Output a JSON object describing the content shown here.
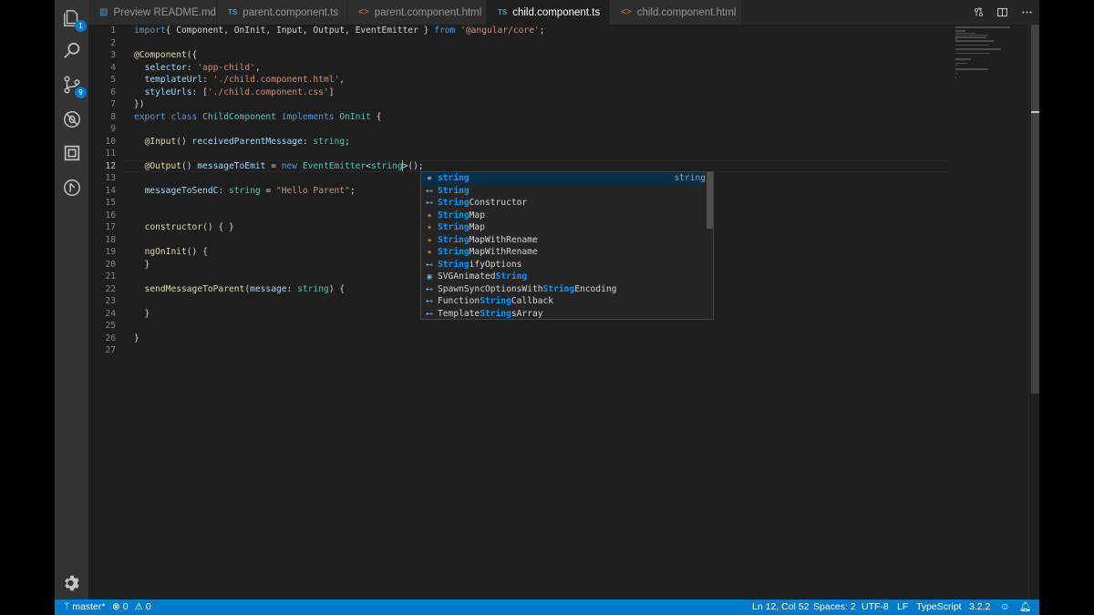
{
  "tabs": [
    {
      "label": "Preview README.md",
      "icon": "preview-icon",
      "active": false
    },
    {
      "label": "parent.component.ts",
      "icon": "ts-icon",
      "icon_text": "TS",
      "active": false
    },
    {
      "label": "parent.component.html",
      "icon": "html-icon",
      "icon_text": "<>",
      "active": false
    },
    {
      "label": "child.component.ts",
      "icon": "ts-icon",
      "icon_text": "TS",
      "active": true,
      "dirty": true
    },
    {
      "label": "child.component.html",
      "icon": "html-icon",
      "icon_text": "<>",
      "active": false
    }
  ],
  "activity_bar": {
    "explorer_badge": "1",
    "scm_badge": "9"
  },
  "editor": {
    "current_line": 12,
    "lines": [
      {
        "n": "1",
        "segments": [
          [
            "kw",
            "import"
          ],
          [
            "",
            "{ Component, OnInit, Input, Output, EventEmitter } "
          ],
          [
            "kw",
            "from"
          ],
          [
            "",
            " "
          ],
          [
            "str",
            "'@angular/core'"
          ],
          [
            "",
            ";"
          ]
        ]
      },
      {
        "n": "2",
        "segments": []
      },
      {
        "n": "3",
        "segments": [
          [
            "dec",
            "@Component"
          ],
          [
            "",
            "({"
          ]
        ]
      },
      {
        "n": "4",
        "segments": [
          [
            "",
            "  "
          ],
          [
            "prop",
            "selector"
          ],
          [
            "",
            ": "
          ],
          [
            "str",
            "'app-child'"
          ],
          [
            "",
            ","
          ]
        ]
      },
      {
        "n": "5",
        "segments": [
          [
            "",
            "  "
          ],
          [
            "prop",
            "templateUrl"
          ],
          [
            "",
            ": "
          ],
          [
            "str",
            "'./child.component.html'"
          ],
          [
            "",
            ","
          ]
        ]
      },
      {
        "n": "6",
        "segments": [
          [
            "",
            "  "
          ],
          [
            "prop",
            "styleUrls"
          ],
          [
            "",
            ": ["
          ],
          [
            "str",
            "'./child.component.css'"
          ],
          [
            "",
            "]"
          ]
        ]
      },
      {
        "n": "7",
        "segments": [
          [
            "",
            "})"
          ]
        ]
      },
      {
        "n": "8",
        "segments": [
          [
            "kw",
            "export"
          ],
          [
            "",
            " "
          ],
          [
            "kw",
            "class"
          ],
          [
            "",
            " "
          ],
          [
            "cls",
            "ChildComponent"
          ],
          [
            "",
            " "
          ],
          [
            "kw",
            "implements"
          ],
          [
            "",
            " "
          ],
          [
            "cls",
            "OnInit"
          ],
          [
            "",
            " {"
          ]
        ]
      },
      {
        "n": "9",
        "segments": []
      },
      {
        "n": "10",
        "segments": [
          [
            "",
            "  "
          ],
          [
            "dec",
            "@Input"
          ],
          [
            "",
            "() "
          ],
          [
            "prop",
            "receivedParentMessage"
          ],
          [
            "",
            ": "
          ],
          [
            "type",
            "string"
          ],
          [
            "",
            ";"
          ]
        ]
      },
      {
        "n": "11",
        "segments": []
      },
      {
        "n": "12",
        "segments": [
          [
            "",
            "  "
          ],
          [
            "dec",
            "@Output"
          ],
          [
            "",
            "() "
          ],
          [
            "prop",
            "messageToEmit"
          ],
          [
            "",
            " = "
          ],
          [
            "kw",
            "new"
          ],
          [
            "",
            " "
          ],
          [
            "cls",
            "EventEmitter"
          ],
          [
            "",
            "<"
          ],
          [
            "type",
            "string"
          ],
          [
            "CURSOR",
            ""
          ],
          [
            "",
            ">();"
          ]
        ]
      },
      {
        "n": "13",
        "segments": []
      },
      {
        "n": "14",
        "segments": [
          [
            "",
            "  "
          ],
          [
            "prop",
            "messageToSendC"
          ],
          [
            "",
            ": "
          ],
          [
            "type",
            "string"
          ],
          [
            "",
            " = "
          ],
          [
            "str",
            "\"Hello Parent\""
          ],
          [
            "",
            ";"
          ]
        ]
      },
      {
        "n": "15",
        "segments": []
      },
      {
        "n": "16",
        "segments": []
      },
      {
        "n": "17",
        "segments": [
          [
            "",
            "  "
          ],
          [
            "fn",
            "constructor"
          ],
          [
            "",
            "() { }"
          ]
        ]
      },
      {
        "n": "18",
        "segments": []
      },
      {
        "n": "19",
        "segments": [
          [
            "",
            "  "
          ],
          [
            "fn",
            "ngOnInit"
          ],
          [
            "",
            "() {"
          ]
        ]
      },
      {
        "n": "20",
        "segments": [
          [
            "",
            "  }"
          ]
        ]
      },
      {
        "n": "21",
        "segments": []
      },
      {
        "n": "22",
        "segments": [
          [
            "",
            "  "
          ],
          [
            "fn",
            "sendMessageToParent"
          ],
          [
            "",
            "("
          ],
          [
            "prop",
            "message"
          ],
          [
            "",
            ": "
          ],
          [
            "type",
            "string"
          ],
          [
            "",
            ") {"
          ]
        ]
      },
      {
        "n": "23",
        "segments": []
      },
      {
        "n": "24",
        "segments": [
          [
            "",
            "  }"
          ]
        ]
      },
      {
        "n": "25",
        "segments": []
      },
      {
        "n": "26",
        "segments": [
          [
            "",
            "}"
          ]
        ]
      },
      {
        "n": "27",
        "segments": []
      }
    ]
  },
  "suggestions": [
    {
      "parts": [
        [
          "hl",
          "string"
        ]
      ],
      "icon": "keyword-icon",
      "type": "string",
      "selected": true
    },
    {
      "parts": [
        [
          "hl",
          "String"
        ]
      ],
      "icon": "interface-icon",
      "type": "",
      "selected": false
    },
    {
      "parts": [
        [
          "hl",
          "String"
        ],
        [
          "",
          "Constructor"
        ]
      ],
      "icon": "interface-icon",
      "type": "",
      "selected": false
    },
    {
      "parts": [
        [
          "hl",
          "String"
        ],
        [
          "",
          "Map"
        ]
      ],
      "icon": "class-icon",
      "type": "",
      "selected": false
    },
    {
      "parts": [
        [
          "hl",
          "String"
        ],
        [
          "",
          "Map"
        ]
      ],
      "icon": "class-icon",
      "type": "",
      "selected": false
    },
    {
      "parts": [
        [
          "hl",
          "String"
        ],
        [
          "",
          "MapWithRename"
        ]
      ],
      "icon": "class-icon",
      "type": "",
      "selected": false
    },
    {
      "parts": [
        [
          "hl",
          "String"
        ],
        [
          "",
          "MapWithRename"
        ]
      ],
      "icon": "class-icon",
      "type": "",
      "selected": false
    },
    {
      "parts": [
        [
          "hl",
          "String"
        ],
        [
          "",
          "ifyOptions"
        ]
      ],
      "icon": "interface-icon",
      "type": "",
      "selected": false
    },
    {
      "parts": [
        [
          "",
          "SVGAnimated"
        ],
        [
          "hl",
          "String"
        ]
      ],
      "icon": "variable-icon",
      "type": "",
      "selected": false
    },
    {
      "parts": [
        [
          "",
          "SpawnSyncOptionsWith"
        ],
        [
          "hl",
          "String"
        ],
        [
          "",
          "Encoding"
        ]
      ],
      "icon": "interface-icon",
      "type": "",
      "selected": false
    },
    {
      "parts": [
        [
          "",
          "Function"
        ],
        [
          "hl",
          "String"
        ],
        [
          "",
          "Callback"
        ]
      ],
      "icon": "interface-icon",
      "type": "",
      "selected": false
    },
    {
      "parts": [
        [
          "",
          "Template"
        ],
        [
          "hl",
          "String"
        ],
        [
          "",
          "sArray"
        ]
      ],
      "icon": "interface-icon",
      "type": "",
      "selected": false
    }
  ],
  "statusbar": {
    "branch": "master*",
    "errors": "0",
    "warnings": "0",
    "position": "Ln 12, Col 52",
    "spaces": "Spaces: 2",
    "encoding": "UTF-8",
    "eol": "LF",
    "language": "TypeScript",
    "version": "3.2.2"
  },
  "colors": {
    "accent": "#007acc",
    "editor_bg": "#1e1e1e",
    "keyword": "#569cd6",
    "string": "#ce9178",
    "class": "#4ec9b0",
    "match_highlight": "#0097fb"
  }
}
